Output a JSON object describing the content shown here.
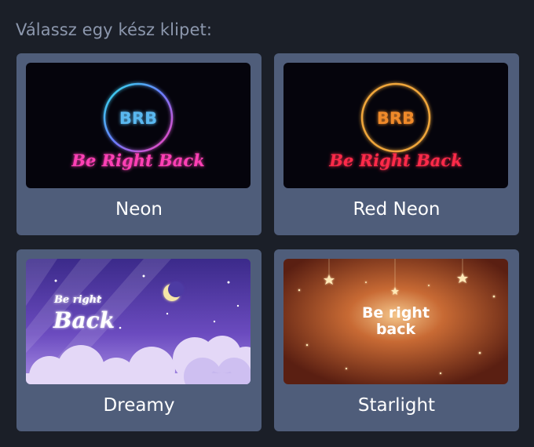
{
  "heading": "Válassz egy kész klipet:",
  "clips": [
    {
      "label": "Neon",
      "badge": "BRB",
      "caption": "Be Right Back"
    },
    {
      "label": "Red Neon",
      "badge": "BRB",
      "caption": "Be Right Back"
    },
    {
      "label": "Dreamy",
      "caption_line1": "Be right",
      "caption_line2": "Back"
    },
    {
      "label": "Starlight",
      "caption_line1": "Be right",
      "caption_line2": "back"
    }
  ],
  "colors": {
    "background": "#1b1f28",
    "card": "#4f5d7a",
    "heading": "#8c97ad",
    "neon_ring": "#34d6e8",
    "neon_badge": "#5ab8f0",
    "neon_caption": "#ff3fb5",
    "red_ring": "#f0a63a",
    "red_badge": "#f08a2a",
    "red_caption": "#ff2a4a"
  }
}
